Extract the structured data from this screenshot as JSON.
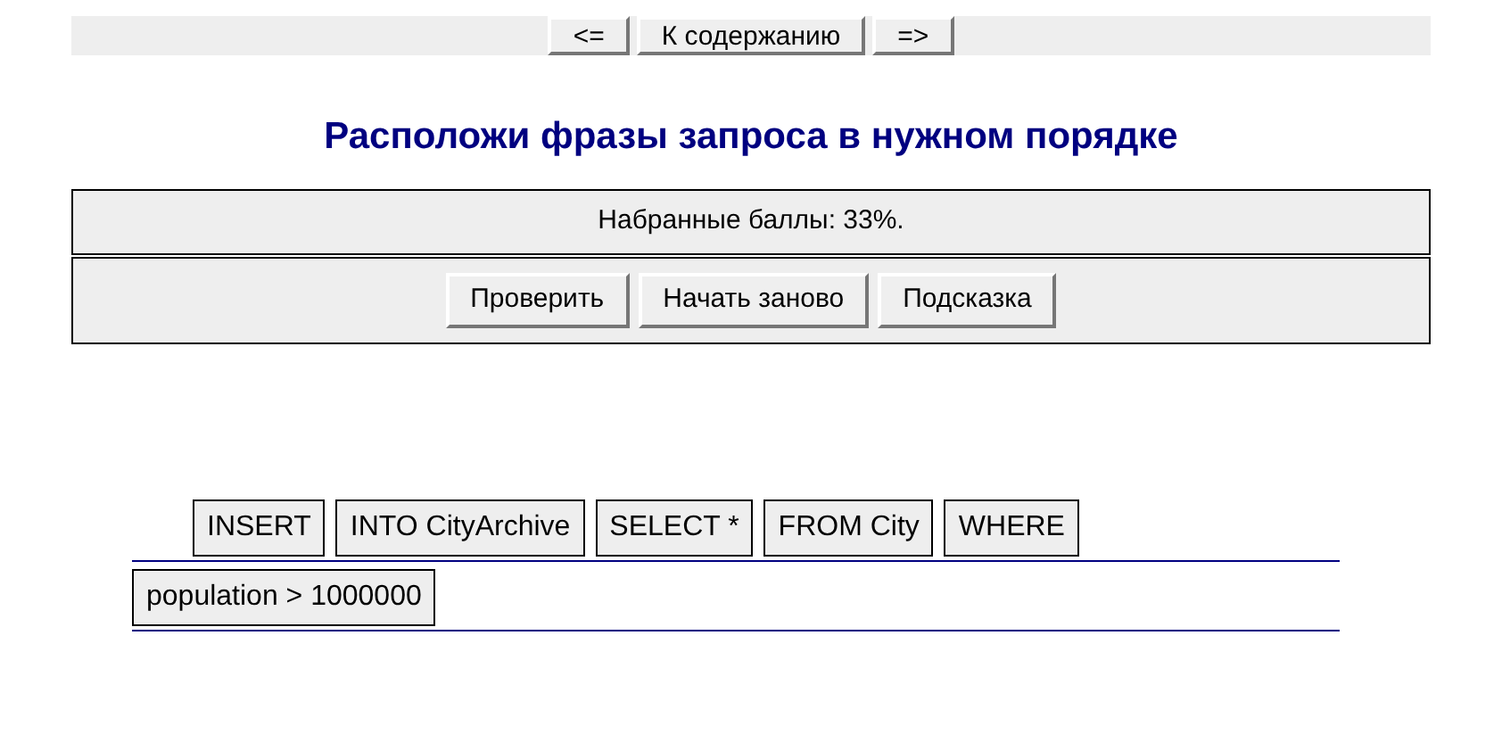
{
  "nav": [
    "<=",
    "К содержанию",
    "=>"
  ],
  "title": "Расположи фразы запроса в нужном порядке",
  "score": "Набранные баллы: 33%.",
  "actions": [
    "Проверить",
    "Начать заново",
    "Подсказка"
  ],
  "answer_chips": [
    "INSERT",
    "INTO CityArchive",
    "SELECT *",
    "FROM City",
    "WHERE"
  ],
  "pool_chips": [
    "population > 1000000"
  ]
}
